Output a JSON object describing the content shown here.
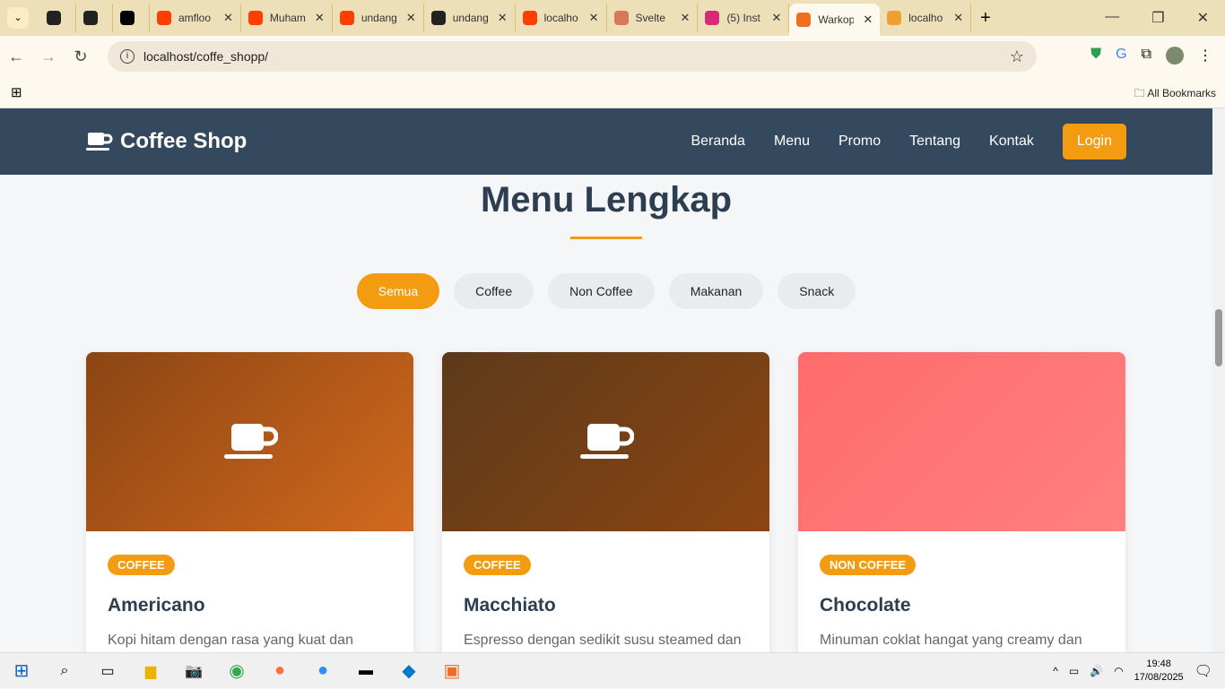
{
  "browser": {
    "tabs": [
      {
        "label": "",
        "icon": "chatgpt-icon",
        "color": "#222"
      },
      {
        "label": "",
        "icon": "github-icon",
        "color": "#222"
      },
      {
        "label": "",
        "icon": "vercel-icon",
        "color": "#000"
      },
      {
        "label": "amfloo",
        "icon": "svelte-icon",
        "color": "#ff3e00"
      },
      {
        "label": "Muham",
        "icon": "svelte-icon",
        "color": "#ff3e00"
      },
      {
        "label": "undang",
        "icon": "svelte-icon",
        "color": "#ff3e00"
      },
      {
        "label": "undang",
        "icon": "github-icon",
        "color": "#222"
      },
      {
        "label": "localho",
        "icon": "svelte-icon",
        "color": "#ff3e00"
      },
      {
        "label": "Svelte",
        "icon": "claude-icon",
        "color": "#d97757"
      },
      {
        "label": "(5) Inst",
        "icon": "instagram-icon",
        "color": "#d62976"
      },
      {
        "label": "Warkop",
        "icon": "xampp-icon",
        "color": "#f26c22",
        "active": true
      },
      {
        "label": "localho",
        "icon": "phpmyadmin-icon",
        "color": "#f0a030"
      }
    ],
    "url": "localhost/coffe_shopp/",
    "bookmarks_label": "All Bookmarks"
  },
  "site": {
    "brand": "Coffee Shop",
    "nav": [
      "Beranda",
      "Menu",
      "Promo",
      "Tentang",
      "Kontak"
    ],
    "login": "Login",
    "title": "Menu Lengkap",
    "filters": [
      "Semua",
      "Coffee",
      "Non Coffee",
      "Makanan",
      "Snack"
    ],
    "cards": [
      {
        "badge": "COFFEE",
        "name": "Americano",
        "desc": "Kopi hitam dengan rasa yang kuat dan crema yang menggugah selera",
        "gradient": [
          "#8b4513",
          "#d2691e"
        ]
      },
      {
        "badge": "COFFEE",
        "name": "Macchiato",
        "desc": "Espresso dengan sedikit susu steamed dan foam yang lembut",
        "gradient": [
          "#5d3a1a",
          "#8b4513"
        ]
      },
      {
        "badge": "NON COFFEE",
        "name": "Chocolate",
        "desc": "Minuman coklat hangat yang creamy dan lezat",
        "gradient": [
          "#ff6b6b",
          "#ff8080"
        ]
      }
    ]
  },
  "taskbar": {
    "time": "19:48",
    "date": "17/08/2025"
  }
}
